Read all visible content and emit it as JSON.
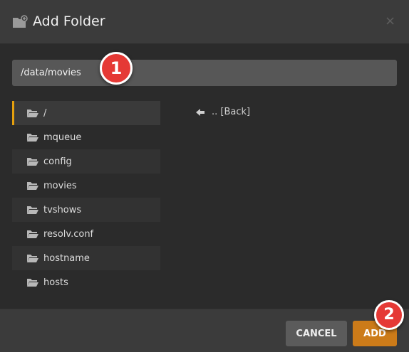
{
  "dialog": {
    "title": "Add Folder",
    "title_icon": "folder-add-icon",
    "close_icon": "close-icon",
    "close_glyph": "×"
  },
  "path_input": {
    "value": "/data/movies"
  },
  "folders": [
    {
      "name": "/",
      "selected": true
    },
    {
      "name": "mqueue",
      "selected": false
    },
    {
      "name": "config",
      "selected": false
    },
    {
      "name": "movies",
      "selected": false
    },
    {
      "name": "tvshows",
      "selected": false
    },
    {
      "name": "resolv.conf",
      "selected": false
    },
    {
      "name": "hostname",
      "selected": false
    },
    {
      "name": "hosts",
      "selected": false
    }
  ],
  "back": {
    "label": ".. [Back]",
    "icon": "arrow-left-icon"
  },
  "footer": {
    "cancel_label": "CANCEL",
    "add_label": "ADD"
  },
  "annotations": {
    "badge1": "1",
    "badge2": "2"
  },
  "colors": {
    "accent": "#e5a00d",
    "add_button": "#cc7b19",
    "badge": "#e53935"
  }
}
